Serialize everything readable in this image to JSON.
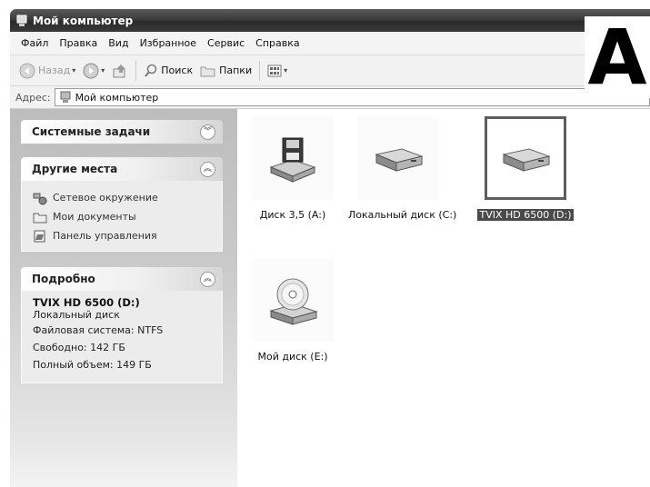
{
  "window": {
    "title": "Мой компьютер"
  },
  "menu": [
    "Файл",
    "Правка",
    "Вид",
    "Избранное",
    "Сервис",
    "Справка"
  ],
  "toolbar": {
    "back_label": "Назад",
    "search_label": "Поиск",
    "folders_label": "Папки"
  },
  "address": {
    "label": "Адрес:",
    "value": "Мой компьютер"
  },
  "corner_letter": "A",
  "tasks": {
    "system": {
      "title": "Системные задачи"
    },
    "other": {
      "title": "Другие места",
      "items": [
        {
          "label": "Сетевое окружение",
          "icon": "network-icon"
        },
        {
          "label": "Мои документы",
          "icon": "folder-icon"
        },
        {
          "label": "Панель управления",
          "icon": "control-panel-icon"
        }
      ]
    },
    "details": {
      "title": "Подробно",
      "name": "TVIX HD 6500 (D:)",
      "type": "Локальный диск",
      "fs": "Файловая система: NTFS",
      "free": "Свободно: 142 ГБ",
      "total": "Полный объем: 149 ГБ"
    }
  },
  "drives": [
    {
      "label": "Диск 3,5 (A:)",
      "icon": "floppy-drive-icon",
      "selected": false
    },
    {
      "label": "Локальный диск (C:)",
      "icon": "hard-drive-icon",
      "selected": false
    },
    {
      "label": "TVIX HD 6500 (D:)",
      "icon": "hard-drive-icon",
      "selected": true
    },
    {
      "label": "Мой диск (E:)",
      "icon": "cd-drive-icon",
      "selected": false
    }
  ]
}
